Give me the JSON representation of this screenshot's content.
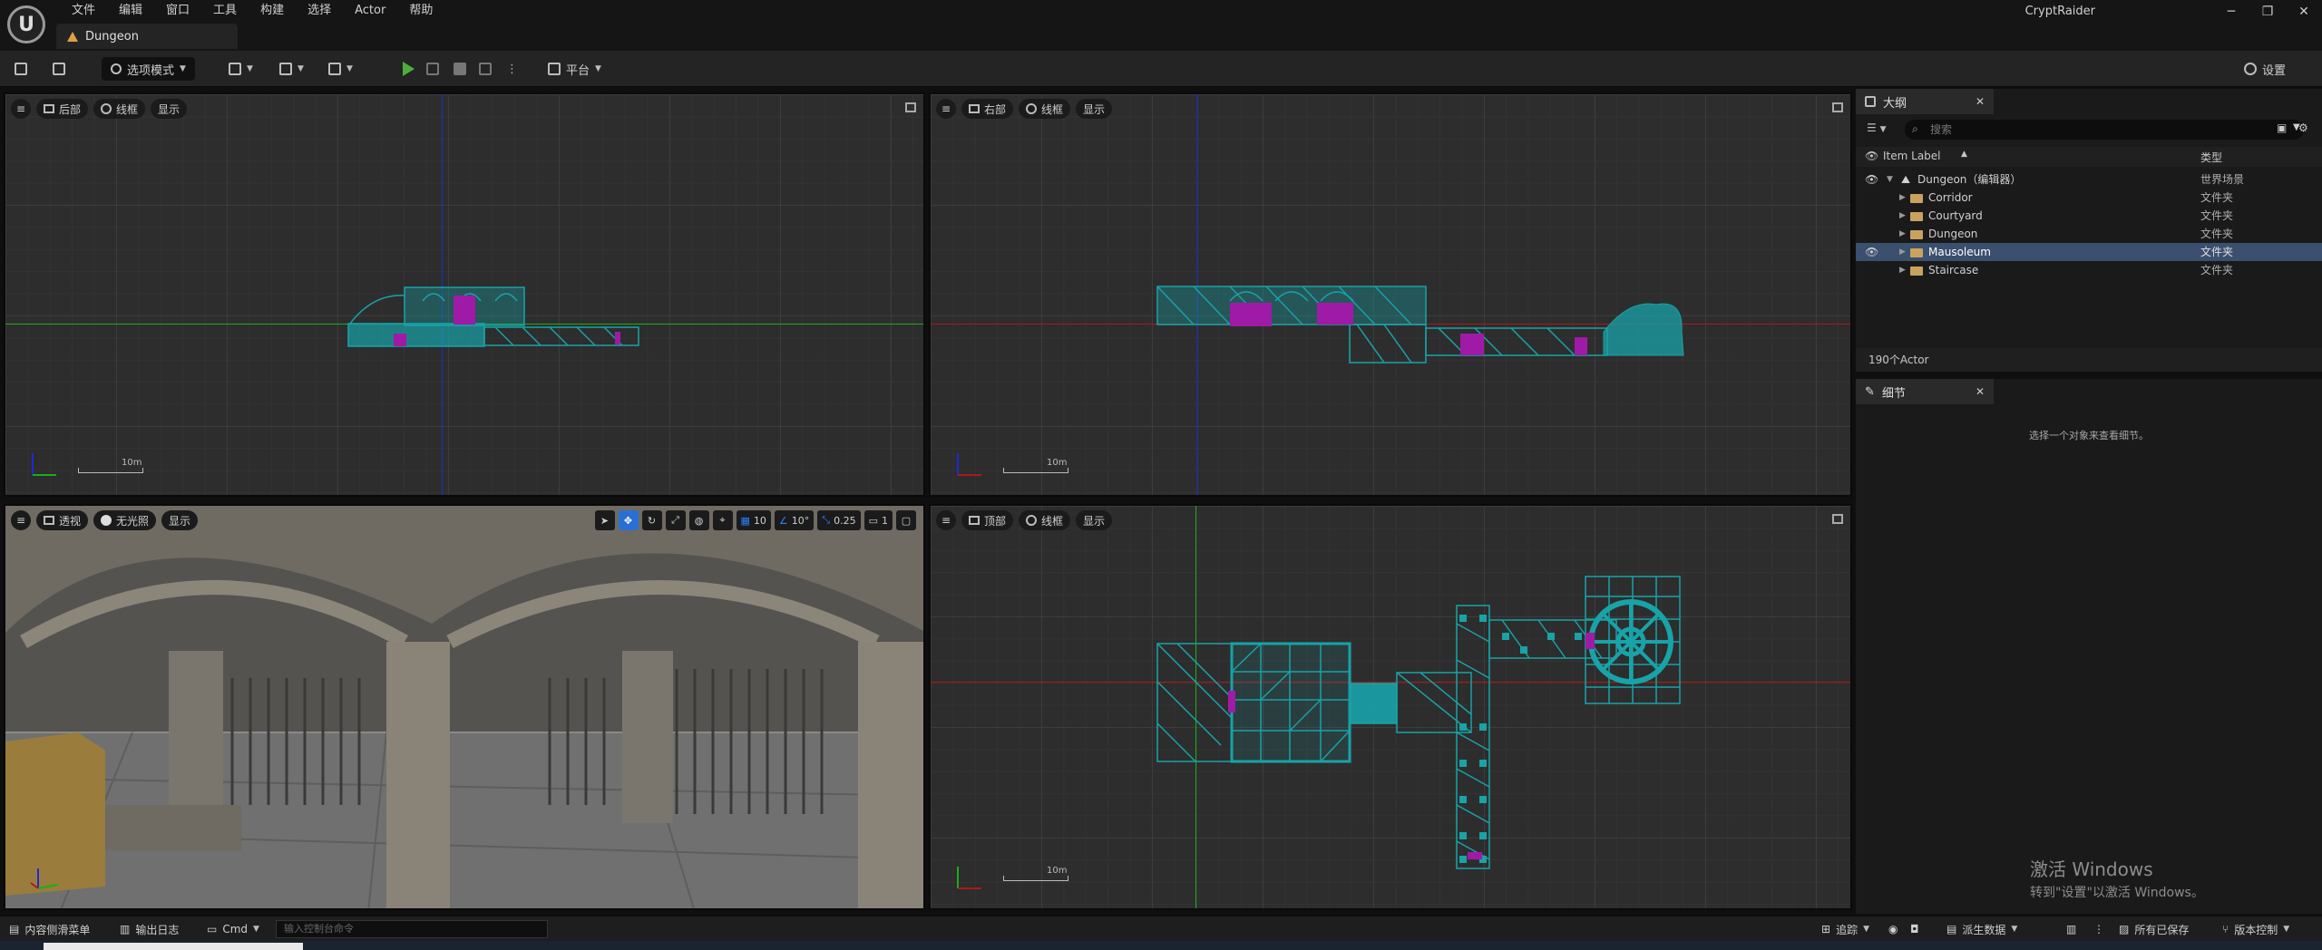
{
  "window": {
    "project_name": "CryptRaider",
    "document_tab": "Dungeon",
    "minimize": "─",
    "restore": "❐",
    "close": "✕"
  },
  "menu": [
    "文件",
    "编辑",
    "窗口",
    "工具",
    "构建",
    "选择",
    "Actor",
    "帮助"
  ],
  "toolbar": {
    "mode_label": "选项模式",
    "platform_label": "平台",
    "settings_label": "设置"
  },
  "viewports": {
    "back": {
      "view_label": "后部",
      "render_label": "线框",
      "show_label": "显示",
      "scale_label": "10m"
    },
    "right": {
      "view_label": "右部",
      "render_label": "线框",
      "show_label": "显示",
      "scale_label": "10m"
    },
    "perspective": {
      "view_label": "透视",
      "render_label": "无光照",
      "show_label": "显示",
      "grid_snap": "10",
      "rotation_snap": "10°",
      "scale_snap": "0.25",
      "camera_speed": "1"
    },
    "top": {
      "view_label": "顶部",
      "render_label": "线框",
      "show_label": "显示",
      "scale_label": "10m"
    }
  },
  "outliner": {
    "tab_label": "大纲",
    "search_placeholder": "搜索",
    "col_label": "Item Label",
    "col_type": "类型",
    "root": {
      "label": "Dungeon（编辑器）",
      "type": "世界场景"
    },
    "folders": [
      {
        "label": "Corridor",
        "type": "文件夹"
      },
      {
        "label": "Courtyard",
        "type": "文件夹"
      },
      {
        "label": "Dungeon",
        "type": "文件夹"
      },
      {
        "label": "Mausoleum",
        "type": "文件夹"
      },
      {
        "label": "Staircase",
        "type": "文件夹"
      }
    ],
    "actor_count": "190个Actor"
  },
  "details": {
    "tab_label": "细节",
    "empty_message": "选择一个对象来查看细节。"
  },
  "watermark": {
    "line1": "激活 Windows",
    "line2": "转到\"设置\"以激活 Windows。"
  },
  "statusbar": {
    "content_drawer": "内容侧滑菜单",
    "output_log": "输出日志",
    "cmd": "Cmd",
    "console_placeholder": "输入控制台命令",
    "trace": "追踪",
    "derived_data": "派生数据",
    "all_saved": "所有已保存",
    "version_control": "版本控制"
  },
  "colors": {
    "wire": "#18a3a8",
    "magenta": "#a01aa8",
    "axis_red": "#b01818",
    "axis_green": "#18b018",
    "axis_blue": "#1c2bd0",
    "selection": "#3b4f6e"
  }
}
